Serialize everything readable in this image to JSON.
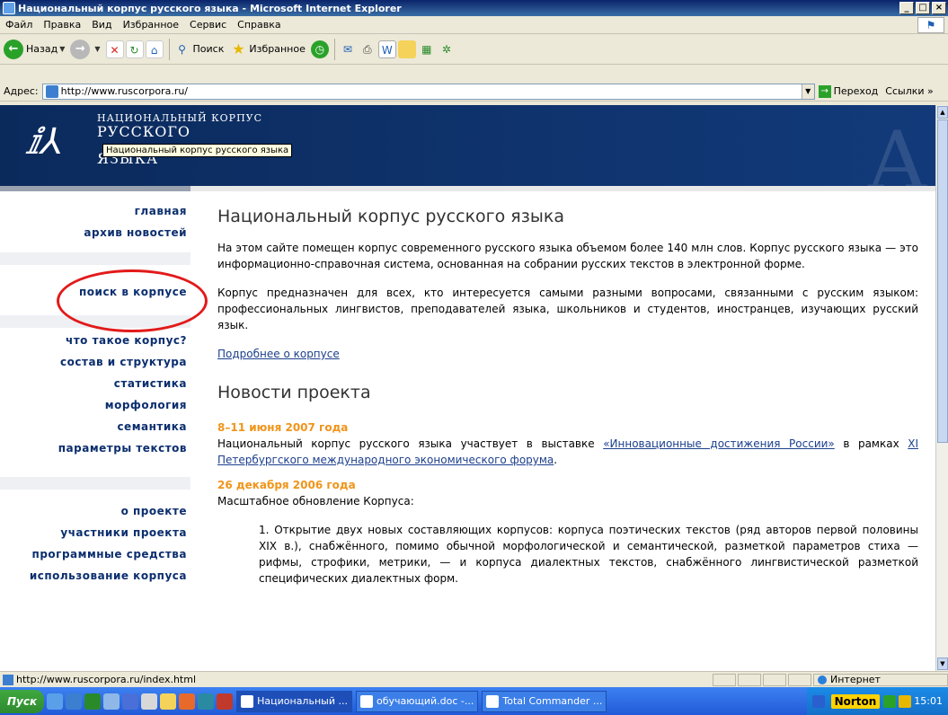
{
  "window": {
    "title": "Национальный корпус русского языка - Microsoft Internet Explorer",
    "btn_min": "_",
    "btn_max": "□",
    "btn_close": "×"
  },
  "menu": [
    "Файл",
    "Правка",
    "Вид",
    "Избранное",
    "Сервис",
    "Справка"
  ],
  "toolbar": {
    "back": "Назад",
    "search": "Поиск",
    "favorites": "Избранное"
  },
  "address": {
    "label": "Адрес:",
    "url": "http://www.ruscorpora.ru/",
    "go": "Переход",
    "links": "Ссылки"
  },
  "banner": {
    "line1": "НАЦИОНАЛЬНЫЙ КОРПУС",
    "line2": "РУССКОГО",
    "line3": "ЯЗЫКА",
    "tooltip": "Национальный корпус русского языка"
  },
  "nav": {
    "group1": [
      "главная",
      "архив новостей"
    ],
    "search": "поиск в корпусе",
    "group2": [
      "что такое корпус?",
      "состав и структура",
      "статистика",
      "морфология",
      "семантика",
      "параметры текстов"
    ],
    "group3": [
      "о проекте",
      "участники проекта",
      "программные средства",
      "использование корпуса"
    ]
  },
  "content": {
    "heading": "Национальный корпус русского языка",
    "para1": "На этом сайте помещен корпус современного русского языка объемом более 140 млн слов. Корпус русского языка — это информационно-справочная система, основанная на собрании русских текстов в электронной форме.",
    "para2": "Корпус предназначен для всех, кто интересуется самыми разными вопросами, связанными с русским языком: профессиональных лингвистов, преподавателей языка, школьников и студентов, иностранцев, изучающих русский язык.",
    "more_link": "Подробнее о корпусе",
    "news_heading": "Новости проекта",
    "news1_date": "8–11 июня 2007 года",
    "news1_pre": "Национальный корпус русского языка участвует в выставке ",
    "news1_link1": "«Инновационные достижения России»",
    "news1_mid": " в рамках ",
    "news1_link2": "XI Петербургского международного экономического форума",
    "news1_post": ".",
    "news2_date": "26 декабря 2006 года",
    "news2_text": "Масштабное обновление Корпуса:",
    "news2_item1": "1. Открытие двух новых составляющих корпусов: корпуса поэтических текстов (ряд авторов первой половины XIX в.), снабжённого, помимо обычной морфологической и семантической, разметкой параметров стиха — рифмы, строфики, метрики, — и корпуса диалектных текстов, снабжённого лингвистической разметкой специфических диалектных форм."
  },
  "status": {
    "url": "http://www.ruscorpora.ru/index.html",
    "zone": "Интернет"
  },
  "taskbar": {
    "start": "Пуск",
    "tasks": [
      "Национальный ...",
      "обучающий.doc -...",
      "Total Commander ..."
    ],
    "norton": "Norton",
    "clock": "15:01"
  }
}
